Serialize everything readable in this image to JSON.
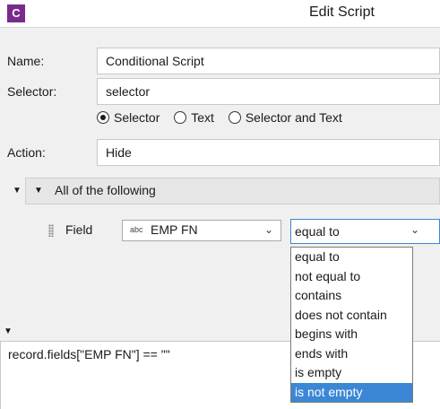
{
  "window": {
    "icon_letter": "C",
    "title": "Edit Script"
  },
  "form": {
    "name_label": "Name:",
    "name_value": "Conditional Script",
    "selector_label": "Selector:",
    "selector_value": "selector",
    "radio_options": [
      {
        "label": "Selector",
        "selected": true
      },
      {
        "label": "Text",
        "selected": false
      },
      {
        "label": "Selector and Text",
        "selected": false
      }
    ],
    "action_label": "Action:",
    "action_value": "Hide"
  },
  "condition": {
    "group_label": "All of the following",
    "field_label": "Field",
    "field_type_badge": "abc",
    "field_value": "EMP FN",
    "operator_value": "equal to",
    "operator_options": [
      "equal to",
      "not equal to",
      "contains",
      "does not contain",
      "begins with",
      "ends with",
      "is empty",
      "is not empty"
    ],
    "highlighted_option": "is not empty"
  },
  "script": {
    "text": "record.fields[\"EMP FN\"] == \"\""
  },
  "colors": {
    "accent": "#7a2a8c",
    "highlight": "#3b87d5"
  }
}
